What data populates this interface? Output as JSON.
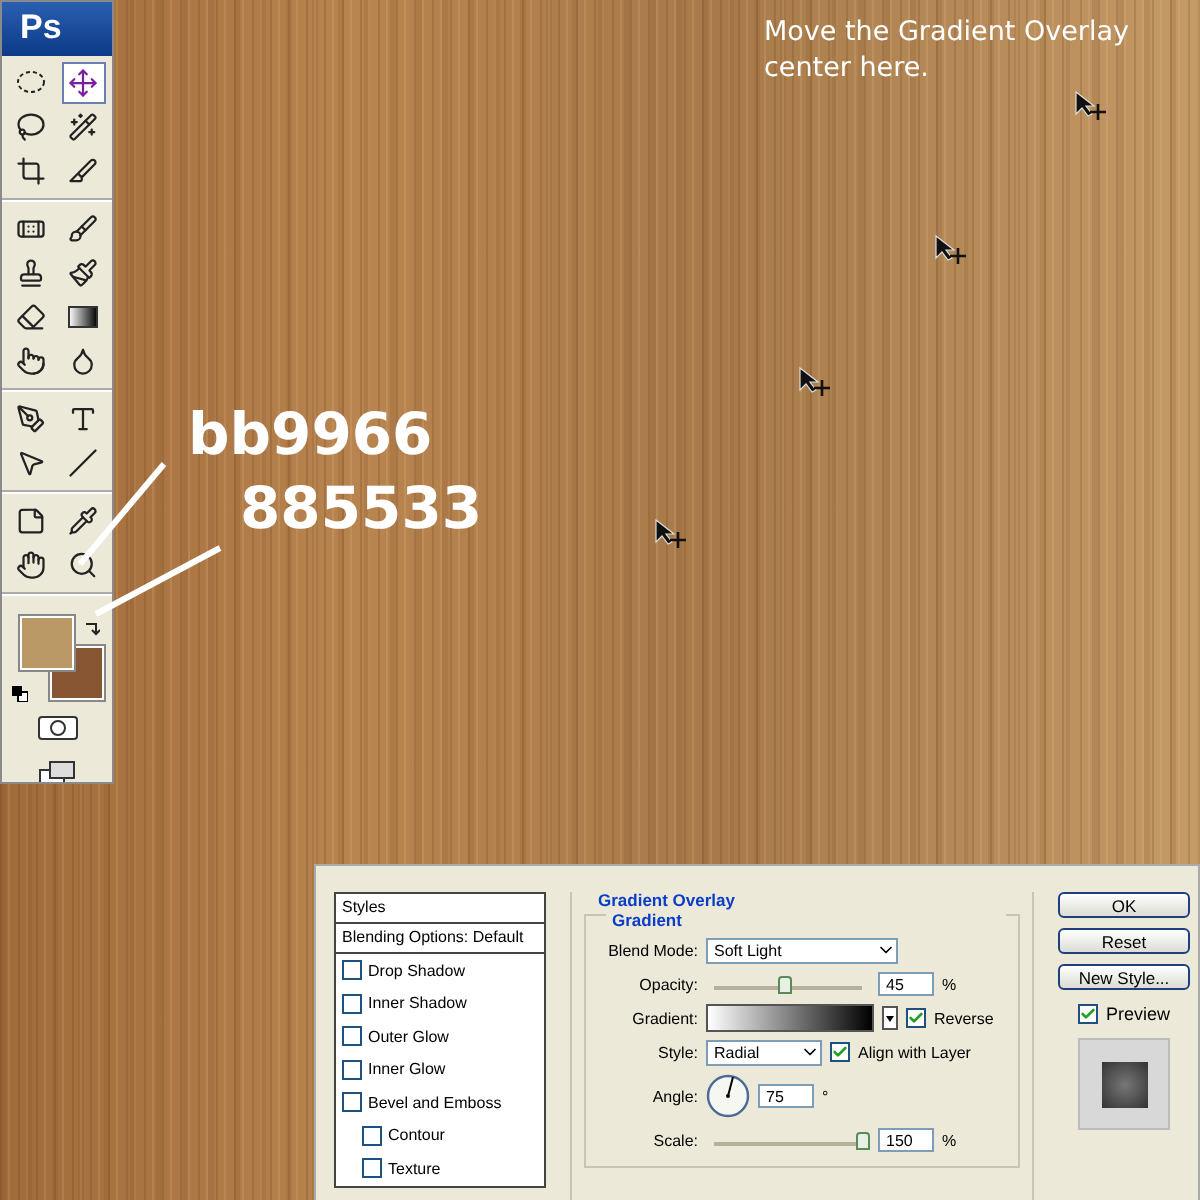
{
  "toolbox": {
    "logo": "Ps",
    "tool_groups": [
      {
        "tools": [
          {
            "kind": "marquee",
            "selected": false
          },
          {
            "kind": "move",
            "selected": true
          },
          {
            "kind": "lasso",
            "selected": false
          },
          {
            "kind": "wand",
            "selected": false
          },
          {
            "kind": "crop",
            "selected": false
          },
          {
            "kind": "slice",
            "selected": false
          }
        ]
      },
      {
        "tools": [
          {
            "kind": "heal",
            "selected": false
          },
          {
            "kind": "brush",
            "selected": false
          },
          {
            "kind": "stamp",
            "selected": false
          },
          {
            "kind": "history",
            "selected": false
          },
          {
            "kind": "eraser",
            "selected": false
          },
          {
            "kind": "gradient",
            "selected": false
          },
          {
            "kind": "smudge",
            "selected": false
          },
          {
            "kind": "dodge",
            "selected": false
          }
        ]
      },
      {
        "tools": [
          {
            "kind": "pen",
            "selected": false
          },
          {
            "kind": "type",
            "selected": false
          },
          {
            "kind": "select",
            "selected": false
          },
          {
            "kind": "line",
            "selected": false
          }
        ]
      },
      {
        "tools": [
          {
            "kind": "notes",
            "selected": false
          },
          {
            "kind": "eyedropper",
            "selected": false
          },
          {
            "kind": "hand",
            "selected": false
          },
          {
            "kind": "zoom",
            "selected": false
          }
        ]
      }
    ],
    "foreground": {
      "color": "#bb9966"
    },
    "background": {
      "color": "#885533"
    }
  },
  "annotations": {
    "note": "Move the Gradient Overlay center here.",
    "foreground_label": "bb9966",
    "background_label": "885533"
  },
  "dialog": {
    "styles": [
      {
        "kind": "header",
        "label": "Styles"
      },
      {
        "kind": "header",
        "label": "Blending Options: Default"
      },
      {
        "kind": "check",
        "label": "Drop Shadow",
        "checked": false
      },
      {
        "kind": "check",
        "label": "Inner Shadow",
        "checked": false
      },
      {
        "kind": "check",
        "label": "Outer Glow",
        "checked": false
      },
      {
        "kind": "check",
        "label": "Inner Glow",
        "checked": false
      },
      {
        "kind": "check",
        "label": "Bevel and Emboss",
        "checked": false,
        "children": [
          {
            "kind": "check",
            "label": "Contour",
            "checked": false
          },
          {
            "kind": "check",
            "label": "Texture",
            "checked": false
          }
        ]
      }
    ],
    "section": "Gradient Overlay",
    "group": "Gradient",
    "blend_mode": {
      "label": "Blend Mode:",
      "value": "Soft Light"
    },
    "opacity": {
      "label": "Opacity:",
      "level": 0.47,
      "value": "45",
      "unit": "%"
    },
    "gradient": {
      "label": "Gradient:",
      "reverse": {
        "label": "Reverse",
        "checked": true
      }
    },
    "style": {
      "label": "Style:",
      "value": "Radial",
      "align": {
        "label": "Align with Layer",
        "checked": true
      }
    },
    "angle": {
      "label": "Angle:",
      "value": "75",
      "unit": "°"
    },
    "scale": {
      "label": "Scale:",
      "level": 1,
      "value": "150",
      "unit": "%"
    },
    "buttons": [
      "OK",
      "Reset",
      "New Style..."
    ],
    "preview": {
      "label": "Preview",
      "checked": true
    }
  }
}
